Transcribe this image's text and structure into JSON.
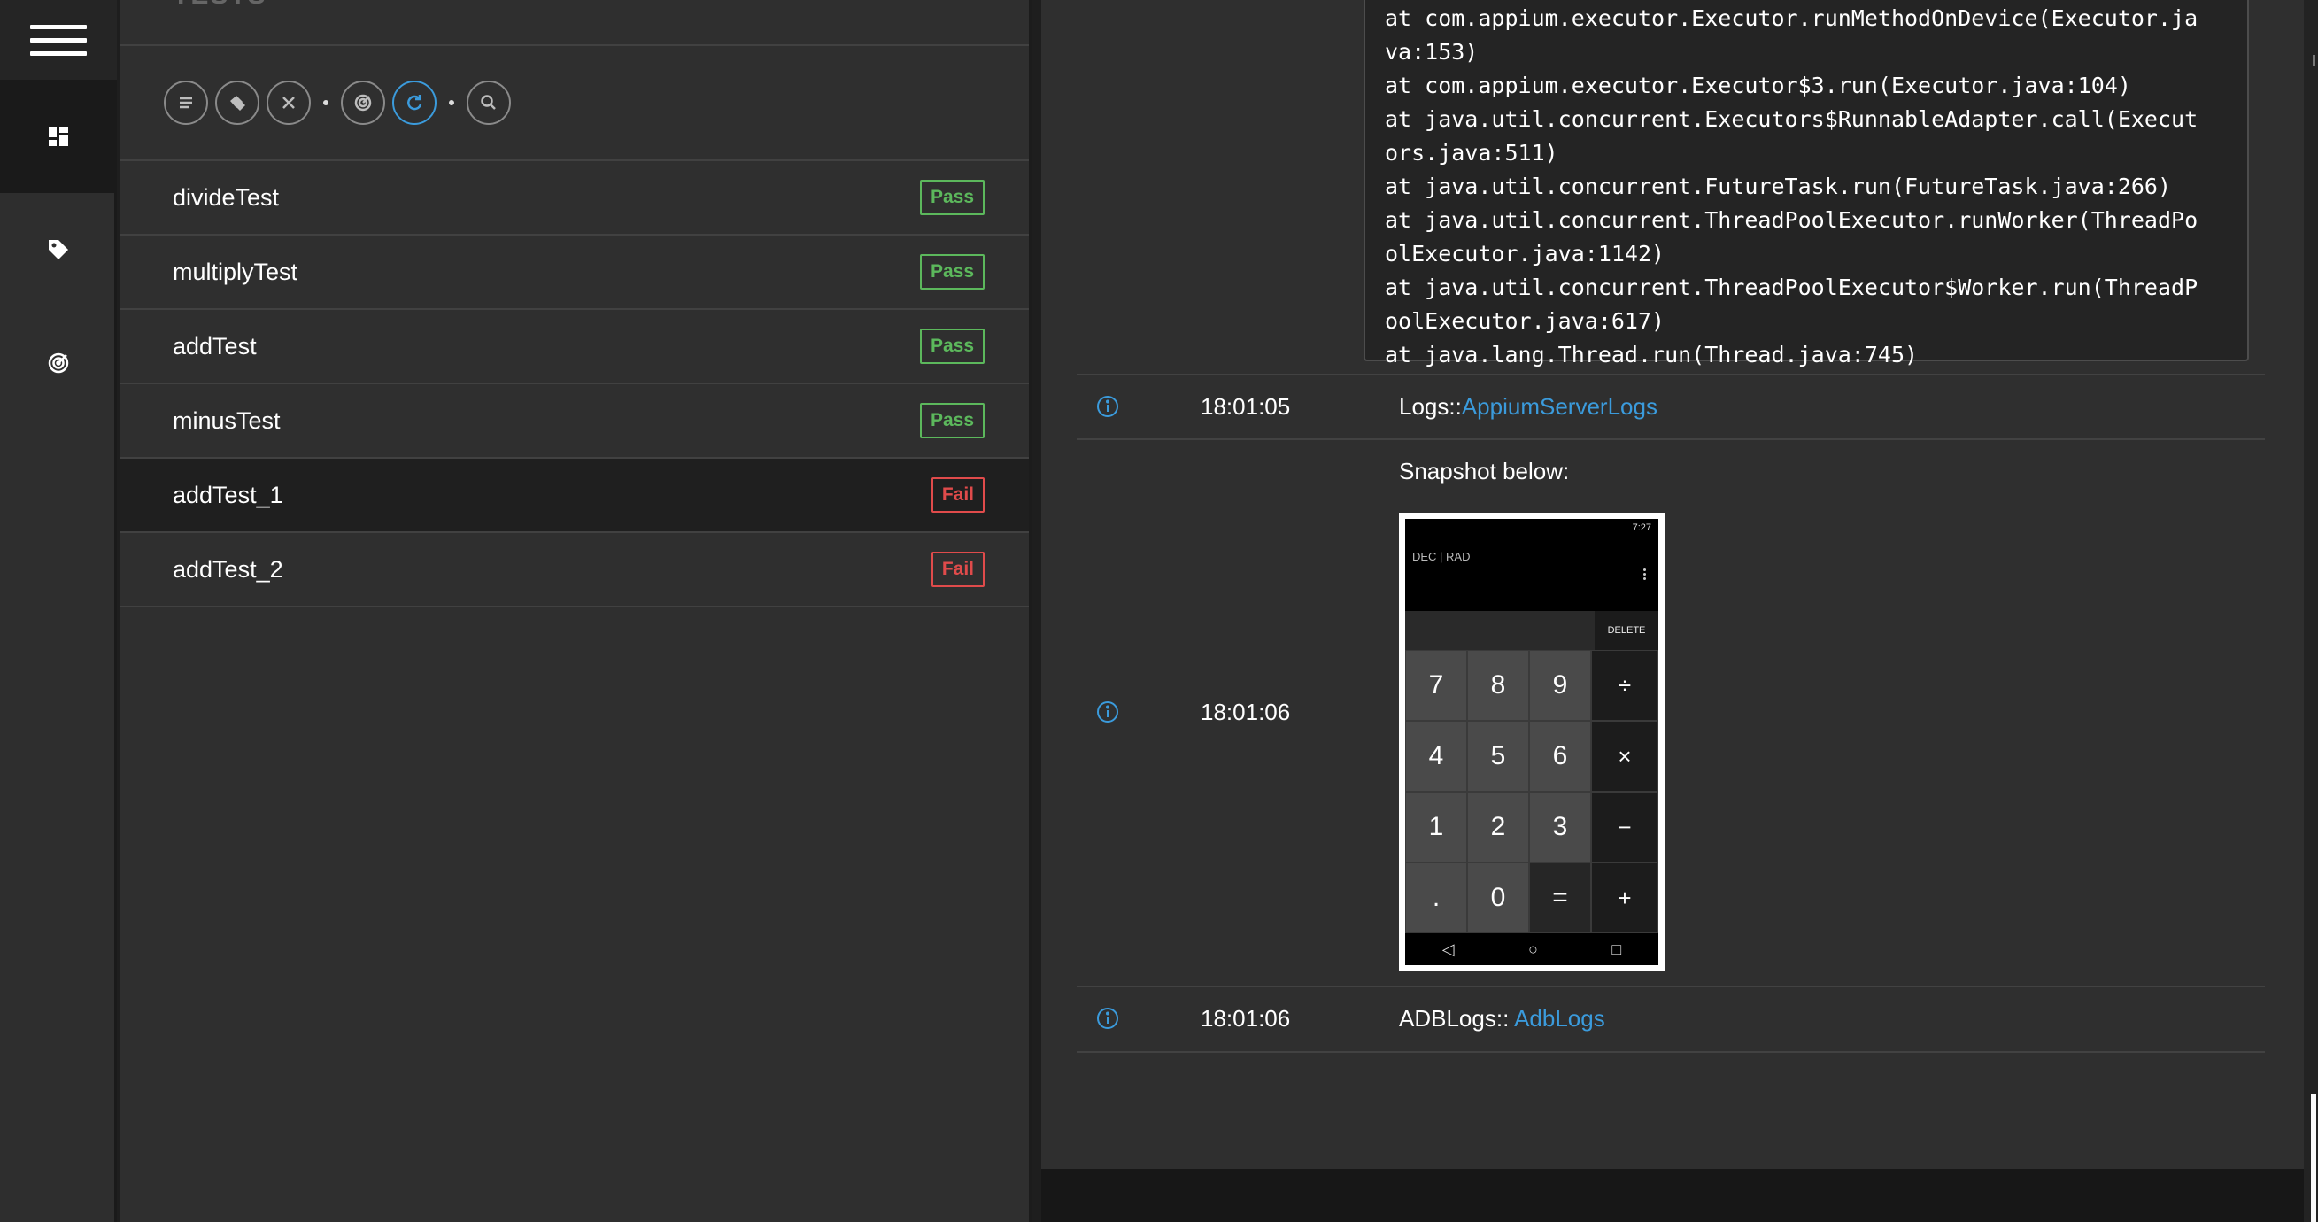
{
  "sidebar": {
    "items": [
      {
        "name": "dashboard",
        "icon": "dashboard-icon"
      },
      {
        "name": "tags",
        "icon": "tag-icon"
      },
      {
        "name": "environment",
        "icon": "radar-icon"
      }
    ]
  },
  "tests_panel": {
    "title": "TESTS",
    "toolbar": [
      {
        "icon": "list-icon"
      },
      {
        "icon": "tags-icon"
      },
      {
        "icon": "clear-icon"
      },
      {
        "icon": "radar-icon"
      },
      {
        "icon": "refresh-icon",
        "active": true
      },
      {
        "icon": "search-icon"
      }
    ],
    "tests": [
      {
        "name": "divideTest",
        "status": "Pass"
      },
      {
        "name": "multiplyTest",
        "status": "Pass"
      },
      {
        "name": "addTest",
        "status": "Pass"
      },
      {
        "name": "minusTest",
        "status": "Pass"
      },
      {
        "name": "addTest_1",
        "status": "Fail",
        "selected": true
      },
      {
        "name": "addTest_2",
        "status": "Fail"
      }
    ]
  },
  "detail": {
    "stack_trace": "at com.appium.executor.Executor.runMethodOnDevice(Executor.ja\nva:153)\nat com.appium.executor.Executor$3.run(Executor.java:104)\nat java.util.concurrent.Executors$RunnableAdapter.call(Execut\nors.java:511)\nat java.util.concurrent.FutureTask.run(FutureTask.java:266)\nat java.util.concurrent.ThreadPoolExecutor.runWorker(ThreadPo\nolExecutor.java:1142)\nat java.util.concurrent.ThreadPoolExecutor$Worker.run(ThreadP\noolExecutor.java:617)\nat java.lang.Thread.run(Thread.java:745)",
    "logs": [
      {
        "time": "18:01:05",
        "prefix": "Logs::",
        "link": "AppiumServerLogs"
      },
      {
        "time": "18:01:06",
        "prefix": "Snapshot below:",
        "link": ""
      },
      {
        "time": "18:01:06",
        "prefix": "ADBLogs:: ",
        "link": "AdbLogs"
      }
    ],
    "snapshot": {
      "status_time": "7:27",
      "mode": "DEC | RAD",
      "delete_label": "DELETE",
      "keys": [
        "7",
        "8",
        "9",
        "÷",
        "4",
        "5",
        "6",
        "×",
        "1",
        "2",
        "3",
        "−",
        ".",
        "0",
        "=",
        "+"
      ],
      "nav": [
        "◁",
        "○",
        "□"
      ]
    }
  },
  "colors": {
    "pass": "#5cb85c",
    "fail": "#e04b4b",
    "link": "#3b9bdc"
  }
}
